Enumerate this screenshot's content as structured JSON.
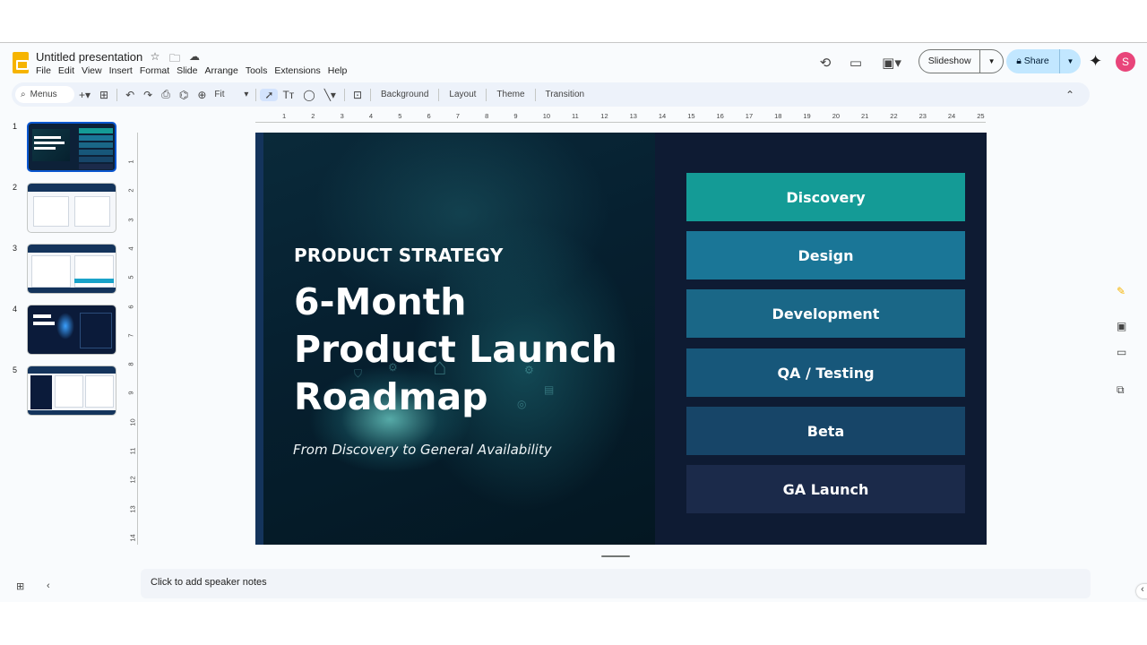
{
  "app": {
    "title": "Untitled presentation",
    "menu": [
      "File",
      "Edit",
      "View",
      "Insert",
      "Format",
      "Slide",
      "Arrange",
      "Tools",
      "Extensions",
      "Help"
    ],
    "slideshow_label": "Slideshow",
    "share_label": "Share",
    "avatar_initial": "S"
  },
  "toolbar": {
    "menus_label": "Menus",
    "zoom_label": "Fit",
    "background_label": "Background",
    "layout_label": "Layout",
    "theme_label": "Theme",
    "transition_label": "Transition"
  },
  "ruler": {
    "horizontal": [
      "1",
      "2",
      "3",
      "4",
      "5",
      "6",
      "7",
      "8",
      "9",
      "10",
      "11",
      "12",
      "13",
      "14",
      "15",
      "16",
      "17",
      "18",
      "19",
      "20",
      "21",
      "22",
      "23",
      "24",
      "25"
    ],
    "vertical": [
      "1",
      "2",
      "3",
      "4",
      "5",
      "6",
      "7",
      "8",
      "9",
      "10",
      "11",
      "12",
      "13",
      "14"
    ]
  },
  "filmstrip": {
    "slides": [
      {
        "number": "1",
        "selected": true
      },
      {
        "number": "2",
        "selected": false
      },
      {
        "number": "3",
        "selected": false
      },
      {
        "number": "4",
        "selected": false
      },
      {
        "number": "5",
        "selected": false
      }
    ]
  },
  "slide": {
    "eyebrow": "PRODUCT STRATEGY",
    "headline_line1": "6-Month",
    "headline_line2": "Product Launch",
    "headline_line3": "Roadmap",
    "subtitle": "From Discovery to General Availability",
    "phases": [
      {
        "label": "Discovery",
        "color": "#149b96"
      },
      {
        "label": "Design",
        "color": "#1a7697"
      },
      {
        "label": "Development",
        "color": "#1a6787"
      },
      {
        "label": "QA / Testing",
        "color": "#17577a"
      },
      {
        "label": "Beta",
        "color": "#174568"
      },
      {
        "label": "GA Launch",
        "color": "#1b2a4a"
      }
    ]
  },
  "notes": {
    "placeholder": "Click to add speaker notes"
  }
}
